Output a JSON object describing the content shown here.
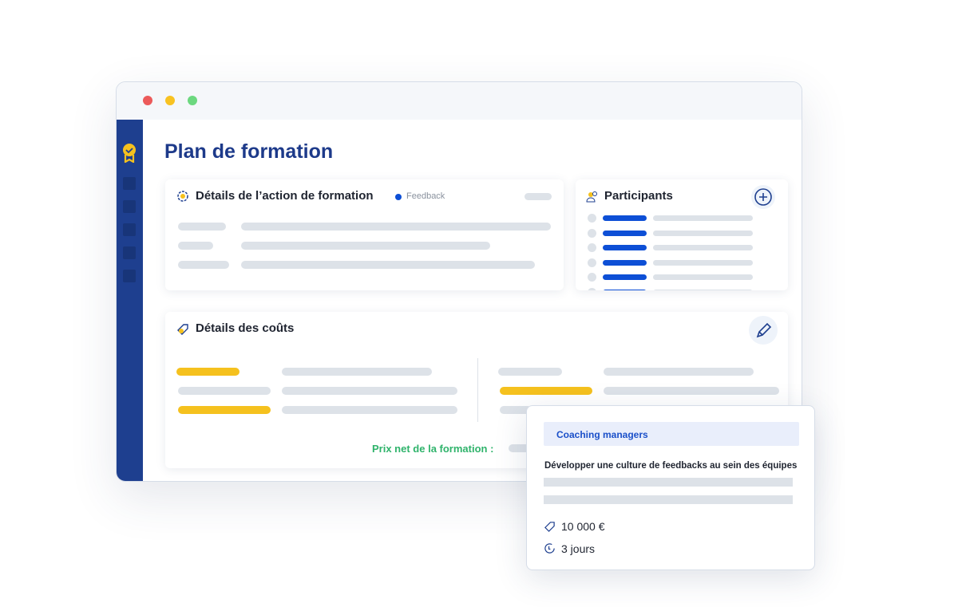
{
  "page": {
    "title": "Plan de formation"
  },
  "window_controls": {
    "close_color": "#ec5a5a",
    "minimize_color": "#f8c221",
    "maximize_color": "#6cd87f"
  },
  "details_card": {
    "title": "Détails de l’action de formation",
    "tag": "Feedback"
  },
  "participants_card": {
    "title": "Participants",
    "add_icon": "plus-circle-icon"
  },
  "costs_card": {
    "title": "Détails des coûts",
    "net_price_label": "Prix net de la formation :",
    "edit_icon": "pencil-icon"
  },
  "popup": {
    "category": "Coaching managers",
    "title": "Développer une culture de feedbacks au sein des équipes",
    "price": "10 000 €",
    "duration": "3 jours"
  }
}
